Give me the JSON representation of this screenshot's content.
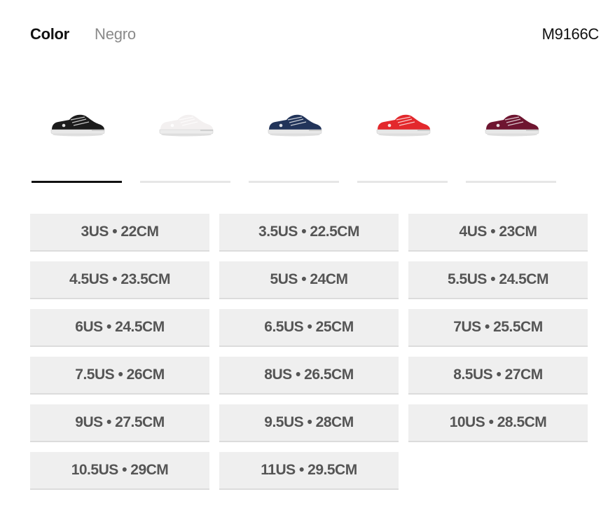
{
  "header": {
    "color_label": "Color",
    "color_value": "Negro",
    "model_code": "M9166C"
  },
  "swatches": [
    {
      "name": "black",
      "icon": "shoe-icon",
      "body": "#1c1c1c",
      "sole": "#e8e8e8",
      "selected": true
    },
    {
      "name": "white",
      "icon": "shoe-icon",
      "body": "#f3f0f0",
      "sole": "#ececec",
      "selected": false
    },
    {
      "name": "navy",
      "icon": "shoe-icon",
      "body": "#22345a",
      "sole": "#e8e8e8",
      "selected": false
    },
    {
      "name": "red",
      "icon": "shoe-icon",
      "body": "#e3282c",
      "sole": "#e8e8e8",
      "selected": false
    },
    {
      "name": "maroon",
      "icon": "shoe-icon",
      "body": "#6e1530",
      "sole": "#e8e8e8",
      "selected": false
    }
  ],
  "sizes": [
    "3US • 22CM",
    "3.5US • 22.5CM",
    "4US • 23CM",
    "4.5US • 23.5CM",
    "5US • 24CM",
    "5.5US • 24.5CM",
    "6US • 24.5CM",
    "6.5US • 25CM",
    "7US • 25.5CM",
    "7.5US • 26CM",
    "8US • 26.5CM",
    "8.5US • 27CM",
    "9US • 27.5CM",
    "9.5US • 28CM",
    "10US • 28.5CM",
    "10.5US • 29CM",
    "11US • 29.5CM"
  ],
  "colors": {
    "button_bg": "#efefef",
    "button_text": "#555555",
    "selected_underline": "#111111",
    "underline": "#e6e6e6"
  }
}
